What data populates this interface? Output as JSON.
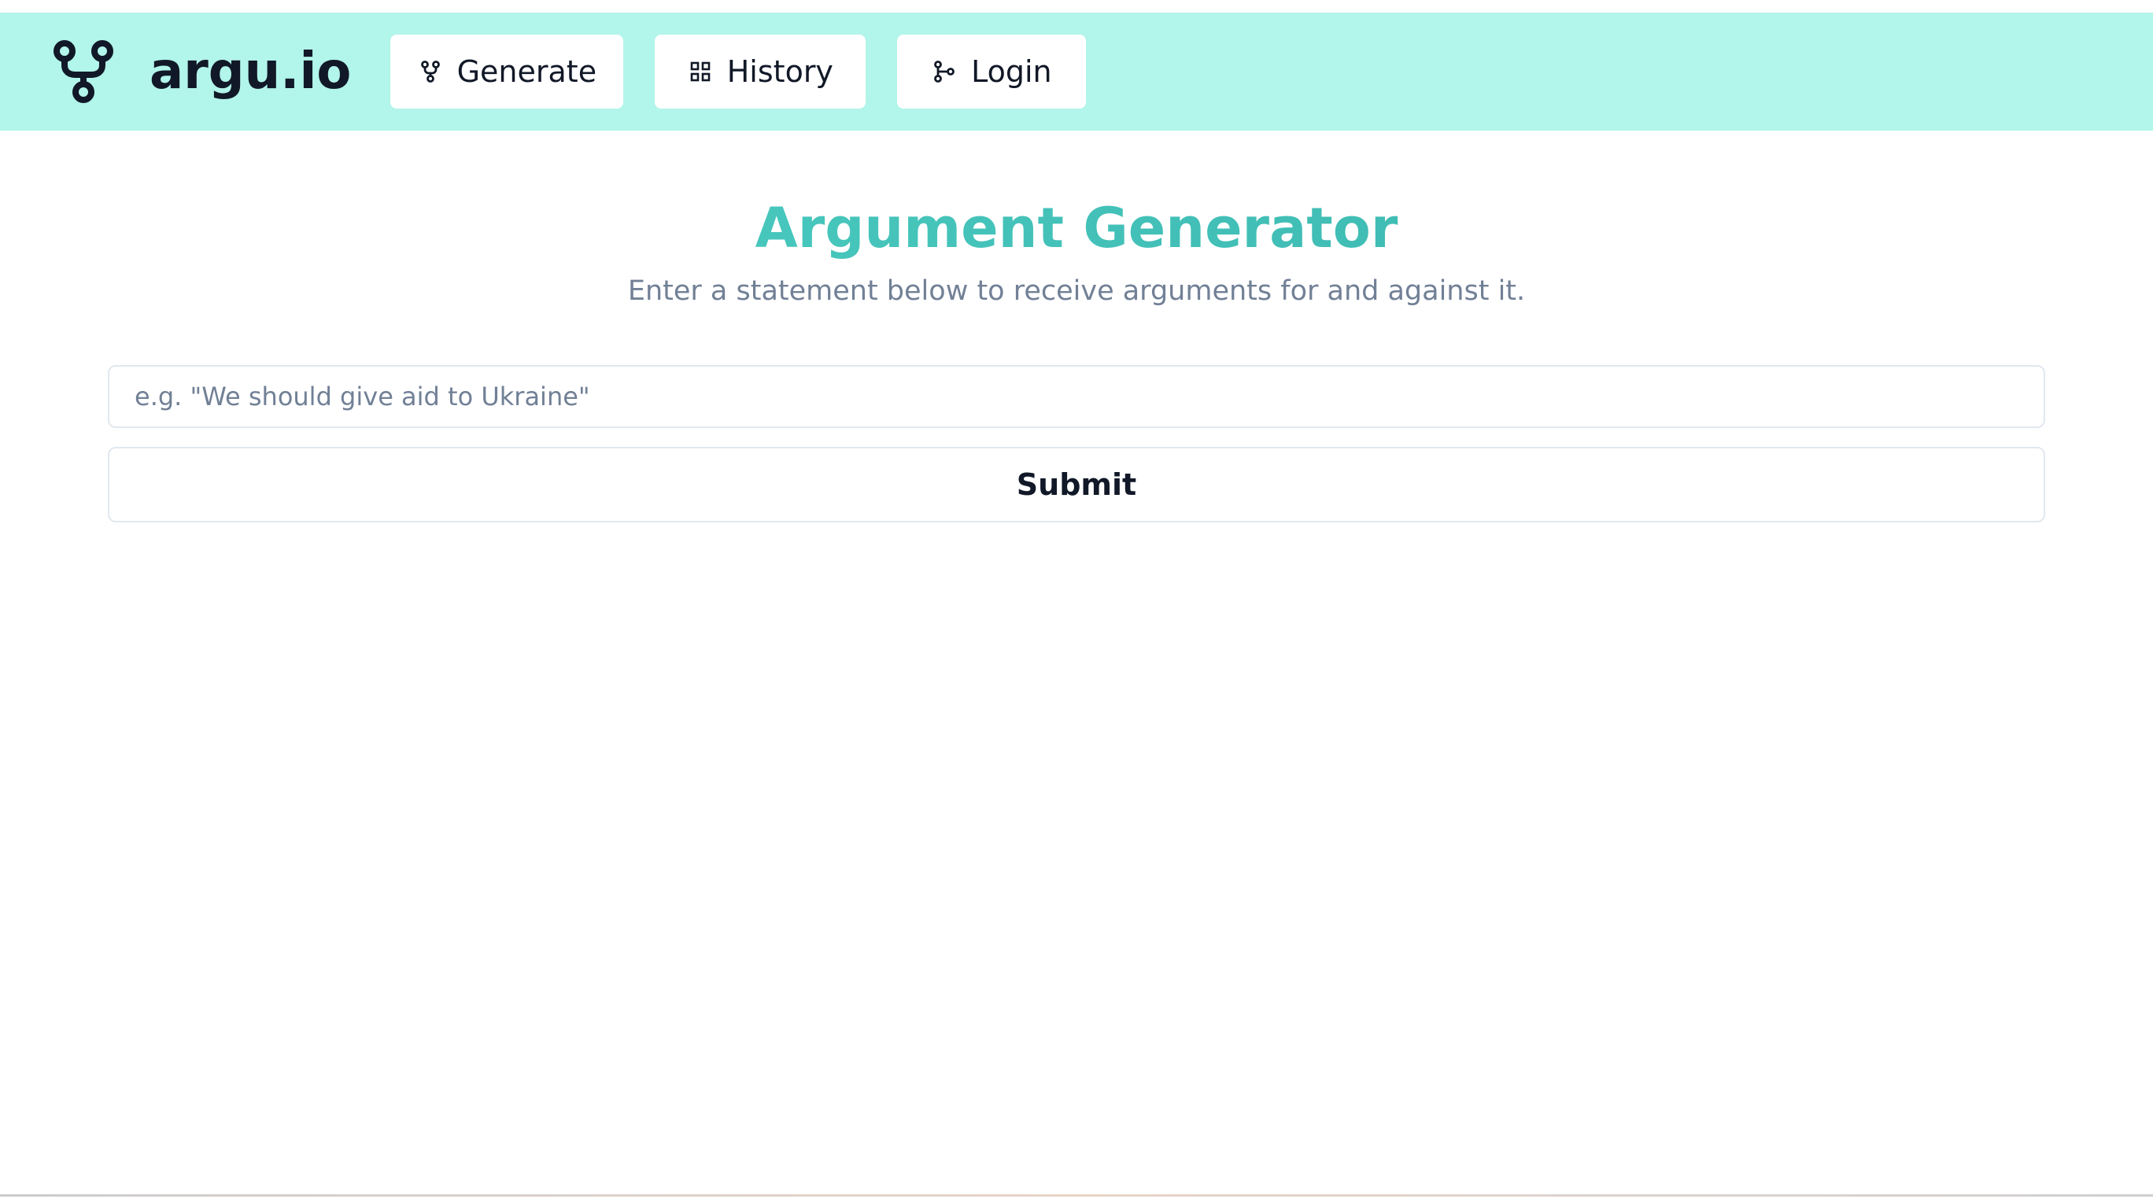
{
  "brand": {
    "name": "argu.io",
    "icon": "branch-fork-icon",
    "color": "#111827"
  },
  "navigation": {
    "background_color": "#b2f5ea",
    "items": [
      {
        "label": "Generate",
        "icon": "fork-icon"
      },
      {
        "label": "History",
        "icon": "grid-icon"
      },
      {
        "label": "Login",
        "icon": "git-branch-icon"
      }
    ]
  },
  "main": {
    "title": "Argument Generator",
    "subtitle": "Enter a statement below to receive arguments for and against it.",
    "title_colors": [
      "#4fd1c5",
      "#38b2ac"
    ],
    "input": {
      "value": "",
      "placeholder": "e.g. \"We should give aid to Ukraine\""
    },
    "submit_label": "Submit"
  }
}
